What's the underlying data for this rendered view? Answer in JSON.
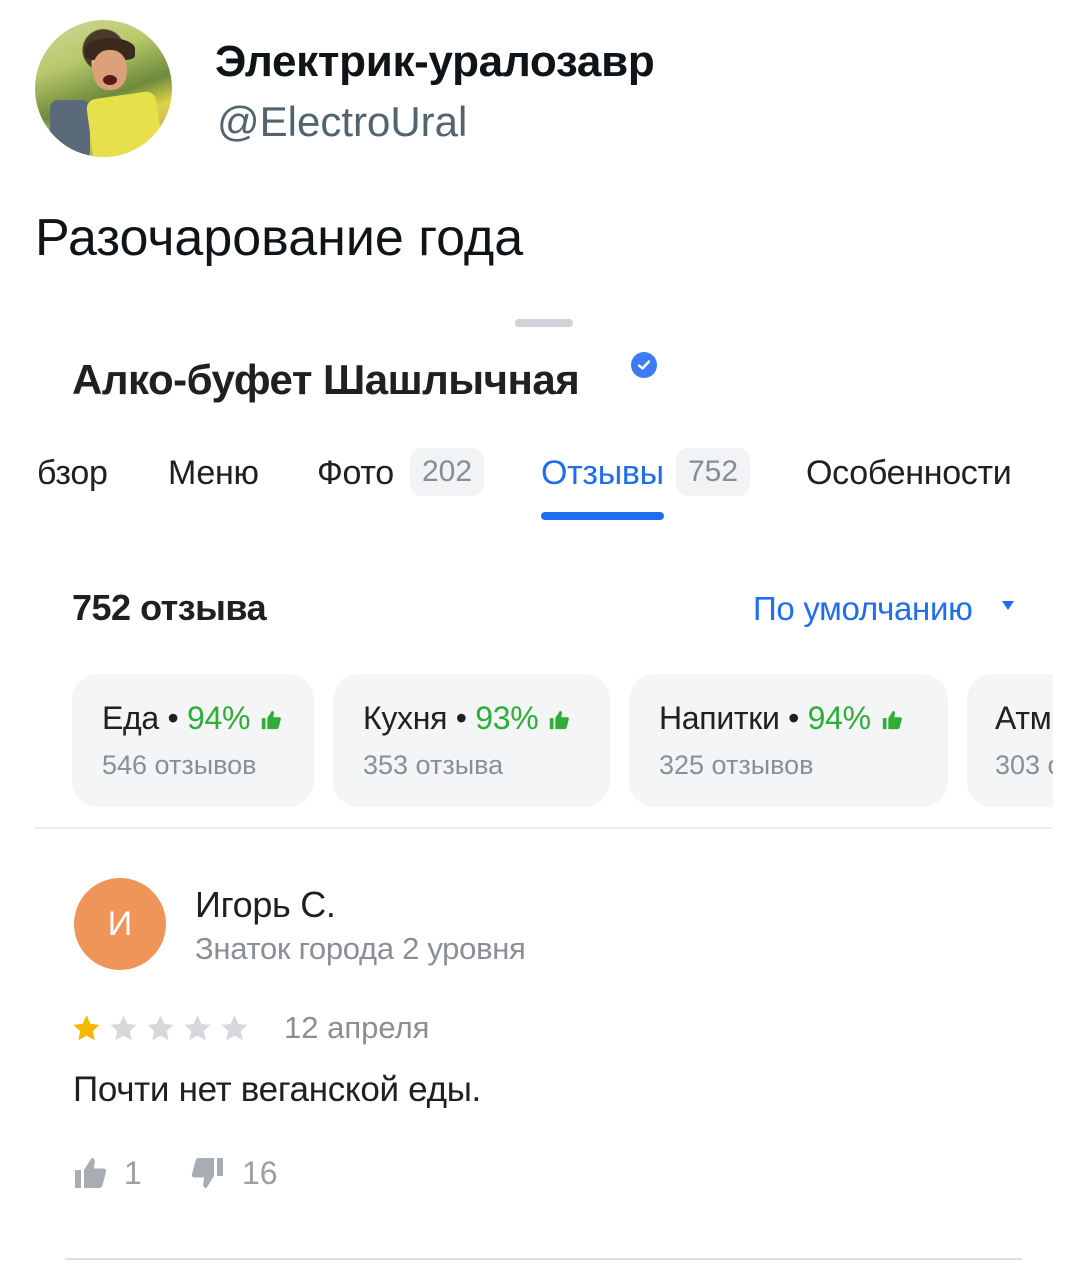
{
  "tweet": {
    "author_name": "Электрик-уралозавр",
    "author_handle": "@ElectroUral",
    "text": "Разочарование года"
  },
  "place": {
    "title": "Алко-буфет Шашлычная",
    "verified": true
  },
  "tabs": [
    {
      "label": "бзор"
    },
    {
      "label": "Меню"
    },
    {
      "label": "Фото",
      "count": "202"
    },
    {
      "label": "Отзывы",
      "count": "752",
      "active": true
    },
    {
      "label": "Особенности"
    }
  ],
  "reviews_header": {
    "count_label": "752 отзыва",
    "sort_label": "По умолчанию"
  },
  "aspect_cards": [
    {
      "name": "Еда",
      "percent": "94%",
      "reviews": "546 отзывов"
    },
    {
      "name": "Кухня",
      "percent": "93%",
      "reviews": "353 отзыва"
    },
    {
      "name": "Напитки",
      "percent": "94%",
      "reviews": "325 отзывов"
    },
    {
      "name": "Атм",
      "percent": "",
      "reviews": "303 о"
    }
  ],
  "review": {
    "avatar_letter": "И",
    "author": "Игорь С.",
    "level": "Знаток города 2 уровня",
    "rating": 1,
    "rating_max": 5,
    "date": "12 апреля",
    "text": "Почти нет веганской еды.",
    "likes": "1",
    "dislikes": "16"
  },
  "colors": {
    "accent": "#1f6ef0",
    "positive": "#2fae35",
    "star_filled": "#f5b800",
    "star_empty": "#d6d8db",
    "avatar_bg": "#f0955a"
  }
}
